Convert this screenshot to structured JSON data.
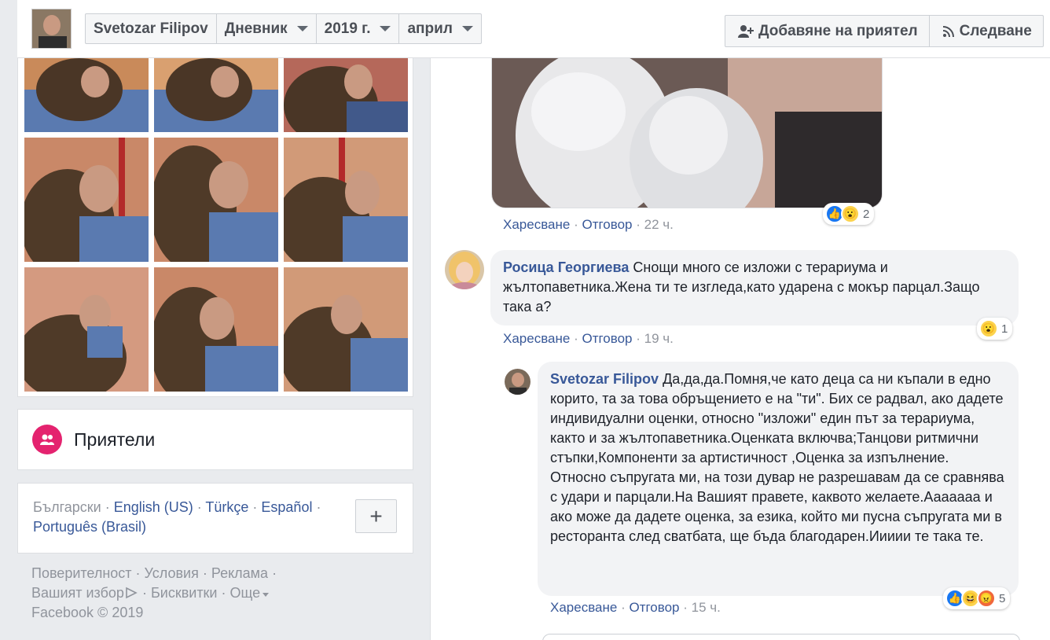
{
  "header": {
    "name": "Svetozar Filipov",
    "selectors": [
      "Дневник",
      "2019 г.",
      "април"
    ],
    "add_friend_label": "Добавяне на приятел",
    "follow_label": "Следване",
    "icons": {
      "add_friend": "person-plus-icon",
      "follow": "rss-icon"
    }
  },
  "sidebar": {
    "friends_title": "Приятели",
    "languages": {
      "current": "Български",
      "others": [
        "English (US)",
        "Türkçe",
        "Español",
        "Português (Brasil)"
      ],
      "more_button": "+"
    },
    "footer": {
      "links_line1": [
        "Поверителност",
        "Условия",
        "Реклама"
      ],
      "links_line2": [
        "Вашият избор",
        "Бисквитки",
        "Още"
      ],
      "copyright": "Facebook © 2019"
    }
  },
  "comments": {
    "first_actions": {
      "like": "Харесване",
      "reply": "Отговор",
      "time": "22 ч."
    },
    "first_reactions": {
      "count": "2"
    },
    "c1": {
      "author": "Росица Георгиева",
      "text": "Снощи много се изложи с терариума и жълтопаветника.Жена ти те изгледа,като ударена с мокър парцал.Защо така а?",
      "like": "Харесване",
      "reply": "Отговор",
      "time": "19 ч.",
      "reactions": "1"
    },
    "c2": {
      "author": "Svetozar Filipov",
      "text": "Да,да,да.Помня,че като деца са ни къпали в едно корито, та за това обръщението е на \"ти\". Бих се радвал, ако дадете индивидуални оценки, относно \"изложи\" един път за терариума, както и за жълтопаветника.Оценката включва;Танцови ритмични стъпки,Компоненти за артистичност ,Оценка за изпълнение. Относно съпругата ми, на този дувар не разрешавам да се сравнява с удари и парцали.На Вашият правете, каквото желаете.Ааааааа и ако може да дадете оценка, за езика, който ми пусна съпругата ми в ресторанта след сватбата, ще бъда благодарен.Иииии те така те.",
      "like": "Харесване",
      "reply": "Отговор",
      "time": "15 ч.",
      "reactions": "5"
    }
  },
  "colors": {
    "link": "#385898",
    "friends_badge": "#e4236f",
    "like_blue": "#1877f2"
  }
}
